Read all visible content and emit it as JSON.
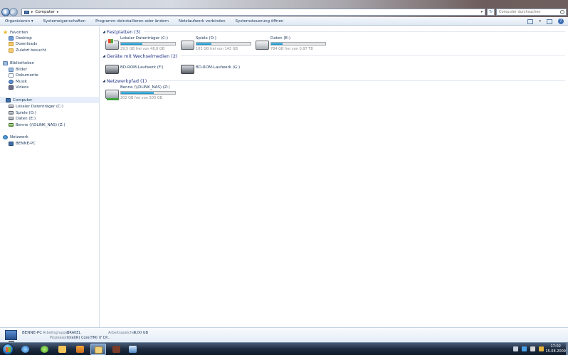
{
  "address_bar": {
    "breadcrumbs": [
      "Computer"
    ],
    "search_placeholder": "Computer durchsuchen"
  },
  "toolbar": {
    "items": [
      "Organisieren ▾",
      "Systemeigenschaften",
      "Programm deinstallieren oder ändern",
      "Netzlaufwerk verbinden",
      "Systemsteuerung öffnen"
    ]
  },
  "nav_pane": {
    "favorites_header": "Favoriten",
    "favorites": [
      "Desktop",
      "Downloads",
      "Zuletzt besucht"
    ],
    "libraries_header": "Bibliotheken",
    "libraries": [
      "Bilder",
      "Dokumente",
      "Musik",
      "Videos"
    ],
    "computer_header": "Computer",
    "computer_items": [
      "Lokaler Datenträger (C:)",
      "Spiele (D:)",
      "Daten (E:)",
      "Benne (\\\\DLINK_NAS) (Z:)"
    ],
    "network_header": "Netzwerk",
    "network_items": [
      "BENNE-PC"
    ]
  },
  "content": {
    "groups": [
      {
        "title": "Festplatten (3)",
        "drives": [
          {
            "name": "Lokaler Datenträger (C:)",
            "free": "29,5 GB frei von 48,8 GB",
            "used_fraction": 0.4
          },
          {
            "name": "Spiele (D:)",
            "free": "103 GB frei von 142 GB",
            "used_fraction": 0.27
          },
          {
            "name": "Daten (E:)",
            "free": "784 GB frei von 0,97 TB",
            "used_fraction": 0.21
          }
        ]
      },
      {
        "title": "Geräte mit Wechselmedien (2)",
        "drives": [
          {
            "name": "BD-ROM-Laufwerk (F:)"
          },
          {
            "name": "BD-ROM-Laufwerk (G:)"
          }
        ]
      },
      {
        "title": "Netzwerkpfad (1)",
        "drives": [
          {
            "name": "Benne (\\\\DLINK_NAS) (Z:)",
            "free": "202 GB frei von 500 GB",
            "used_fraction": 0.6
          }
        ]
      }
    ]
  },
  "details": {
    "pc_name": "BENNE-PC",
    "workgroup_label": "Arbeitsgruppe:",
    "workgroup_value": "BRAKEL",
    "memory_label": "Arbeitsspeicher:",
    "memory_value": "6,00 GB",
    "processor_label": "Prozessor:",
    "processor_value": "Intel(R) Core(TM) i7 CP..."
  },
  "taskbar": {
    "time": "17:02",
    "date": "15.08.2009"
  }
}
